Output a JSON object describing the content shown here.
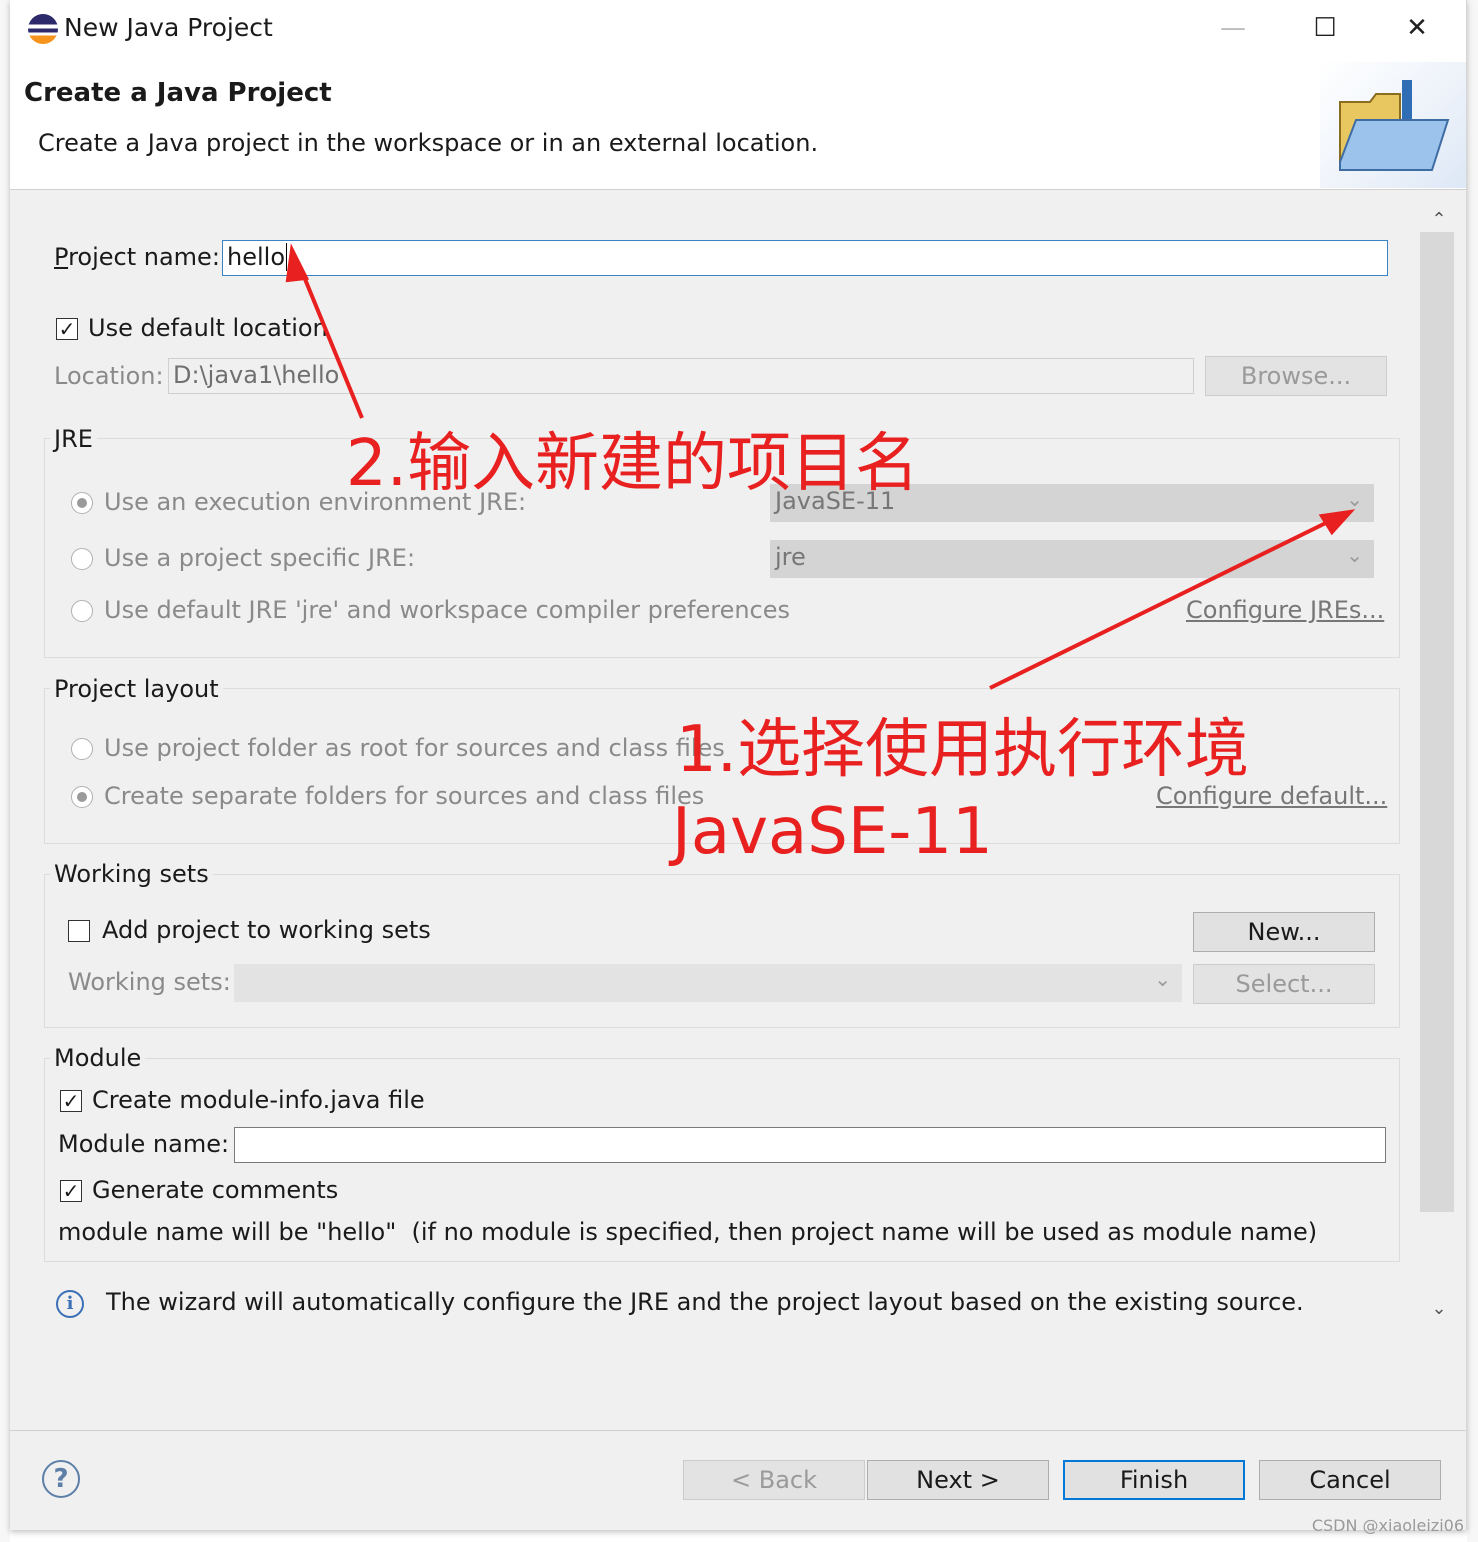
{
  "window": {
    "title": "New Java Project",
    "controls": {
      "minimize": "—",
      "maximize": "☐",
      "close": "✕"
    }
  },
  "header": {
    "title": "Create a Java Project",
    "description": "Create a Java project in the workspace or in an external location."
  },
  "project": {
    "name_label": "Project name:",
    "name_value": "hello",
    "use_default_location_label": "Use default location",
    "use_default_location_checked": true,
    "location_label": "Location:",
    "location_value": "D:\\java1\\hello",
    "browse_label": "Browse..."
  },
  "jre": {
    "group_title": "JRE",
    "options": [
      {
        "label": "Use an execution environment JRE:",
        "selected": true,
        "value": "JavaSE-11"
      },
      {
        "label": "Use a project specific JRE:",
        "selected": false,
        "value": "jre"
      },
      {
        "label": "Use default JRE 'jre' and workspace compiler preferences",
        "selected": false
      }
    ],
    "configure_link": "Configure JREs..."
  },
  "layout": {
    "group_title": "Project layout",
    "options": [
      {
        "label": "Use project folder as root for sources and class files",
        "selected": false
      },
      {
        "label": "Create separate folders for sources and class files",
        "selected": true
      }
    ],
    "configure_link": "Configure default..."
  },
  "working_sets": {
    "group_title": "Working sets",
    "add_label": "Add project to working sets",
    "add_checked": false,
    "new_button": "New...",
    "sets_label": "Working sets:",
    "select_button": "Select..."
  },
  "module": {
    "group_title": "Module",
    "create_label": "Create module-info.java file",
    "create_checked": true,
    "name_label": "Module name:",
    "name_value": "",
    "comments_label": "Generate comments",
    "comments_checked": true,
    "note": "module name will be \"hello\"  (if no module is specified, then project name will be used as module name)"
  },
  "info_message": "The wizard will automatically configure the JRE and the project layout based on the existing source.",
  "buttons": {
    "back": "< Back",
    "next": "Next >",
    "finish": "Finish",
    "cancel": "Cancel"
  },
  "annotations": {
    "step2": "2.输入新建的项目名",
    "step1_line1": "1.选择使用执行环境",
    "step1_line2": "JavaSE-11",
    "color": "#e8201f"
  },
  "watermark": "CSDN @xiaoleizi06",
  "icons": {
    "app": "eclipse-icon",
    "banner": "folder-icon",
    "info": "info-icon",
    "help": "help-icon",
    "scroll_up": "chevron-up-icon",
    "scroll_down": "chevron-down-icon"
  }
}
